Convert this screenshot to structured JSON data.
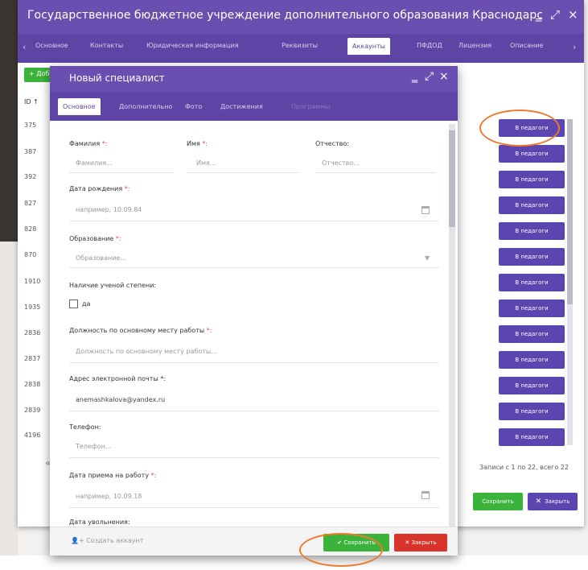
{
  "outer_window": {
    "title": "Государственное бюджетное учреждение дополнительного образования Краснодарского ...",
    "tabs": [
      "Основное",
      "Контакты",
      "Юридическая информация",
      "Реквизиты",
      "Аккаунты",
      "ПФДОД",
      "Лицензия",
      "Описание"
    ],
    "active_tab": "Аккаунты",
    "add_button": "+ Доб",
    "table": {
      "id_header": "ID ↑",
      "ids": [
        "375",
        "387",
        "392",
        "827",
        "828",
        "870",
        "1910",
        "1935",
        "2836",
        "2837",
        "2838",
        "2839",
        "4196"
      ],
      "row_button": "В педагоги"
    },
    "records_text": "Записи с 1 по 22, всего 22",
    "save_label": "Сохранить",
    "close_label": "Закрыть"
  },
  "modal": {
    "title": "Новый специалист",
    "tabs": [
      "Основное",
      "Дополнительно",
      "Фото",
      "Достижения",
      "Программы"
    ],
    "active_tab": "Основное",
    "fields": {
      "lastname_label": "Фамилия",
      "lastname_placeholder": "Фамилия...",
      "firstname_label": "Имя",
      "firstname_placeholder": "Имя...",
      "patronymic_label": "Отчество:",
      "patronymic_placeholder": "Отчество...",
      "birthdate_label": "Дата рождения",
      "birthdate_placeholder": "например, 10.09.84",
      "education_label": "Образование",
      "education_placeholder": "Образование...",
      "degree_label": "Наличие ученой степени:",
      "degree_checkbox_label": "да",
      "position_label": "Должность по основному месту работы",
      "position_placeholder": "Должность по основному месту работы...",
      "email_label": "Адрес электронной почты",
      "email_value": "anemashkalova@yandex.ru",
      "phone_label": "Телефон:",
      "phone_placeholder": "Телефон...",
      "hire_date_label": "Дата приема на работу",
      "hire_date_placeholder": "например, 10.09.18",
      "dismissal_label": "Дата увольнения:"
    },
    "required_mark": "*:",
    "footer": {
      "create_account": "Создать аккаунт",
      "save_label": "Сохранить",
      "close_label": "Закрыть"
    }
  },
  "colors": {
    "title_bar": "#6a4fb0",
    "tab_bar": "#5e44a5",
    "button_purple": "#5b45b0",
    "button_green": "#3bb33b",
    "button_red": "#d9342c",
    "annotation": "#f07a2c"
  }
}
